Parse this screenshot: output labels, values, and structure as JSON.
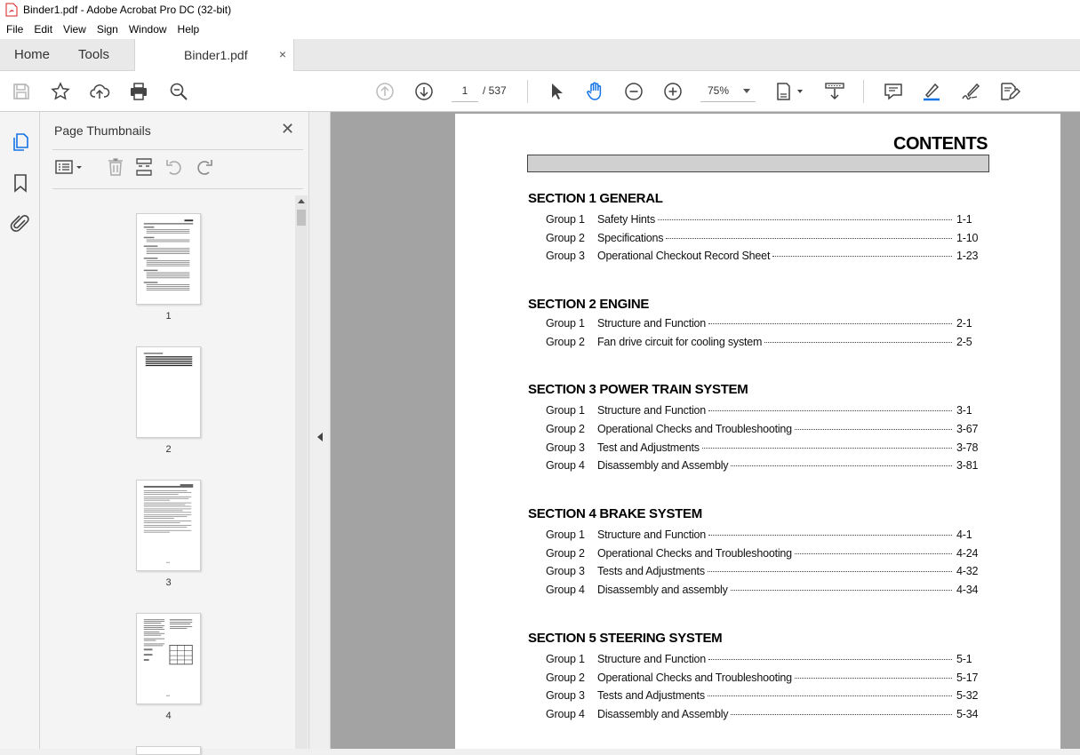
{
  "window": {
    "title": "Binder1.pdf - Adobe Acrobat Pro DC (32-bit)"
  },
  "menu": [
    "File",
    "Edit",
    "View",
    "Sign",
    "Window",
    "Help"
  ],
  "tabs": {
    "home": "Home",
    "tools": "Tools",
    "document": "Binder1.pdf",
    "close": "×"
  },
  "toolbar": {
    "page_current": "1",
    "page_total": "/ 537",
    "zoom": "75%"
  },
  "panel": {
    "title": "Page Thumbnails",
    "close": "✕",
    "thumbnails": [
      "1",
      "2",
      "3",
      "4"
    ]
  },
  "document": {
    "title": "CONTENTS",
    "sections": [
      {
        "heading": "SECTION 1  GENERAL",
        "entries": [
          {
            "group": "Group   1",
            "title": "Safety Hints",
            "page": "1-1"
          },
          {
            "group": "Group   2",
            "title": "Specifications",
            "page": "1-10"
          },
          {
            "group": "Group   3",
            "title": "Operational Checkout Record Sheet",
            "page": "1-23"
          }
        ]
      },
      {
        "heading": "SECTION 2  ENGINE",
        "entries": [
          {
            "group": "Group   1",
            "title": "Structure and Function",
            "page": "2-1"
          },
          {
            "group": "Group   2",
            "title": "Fan drive circuit for cooling system",
            "page": "2-5"
          }
        ]
      },
      {
        "heading": "SECTION 3  POWER TRAIN SYSTEM",
        "entries": [
          {
            "group": "Group   1",
            "title": "Structure and Function",
            "page": "3-1"
          },
          {
            "group": "Group   2",
            "title": "Operational Checks and Troubleshooting",
            "page": "3-67"
          },
          {
            "group": "Group   3",
            "title": "Test and Adjustments",
            "page": "3-78"
          },
          {
            "group": "Group   4",
            "title": "Disassembly and Assembly",
            "page": "3-81"
          }
        ]
      },
      {
        "heading": "SECTION 4  BRAKE SYSTEM",
        "entries": [
          {
            "group": "Group   1",
            "title": "Structure and Function",
            "page": "4-1"
          },
          {
            "group": "Group   2",
            "title": "Operational Checks and Troubleshooting",
            "page": "4-24"
          },
          {
            "group": "Group   3",
            "title": "Tests and Adjustments",
            "page": "4-32"
          },
          {
            "group": "Group   4",
            "title": "Disassembly and assembly",
            "page": "4-34"
          }
        ]
      },
      {
        "heading": "SECTION 5  STEERING SYSTEM",
        "entries": [
          {
            "group": "Group   1",
            "title": "Structure and Function",
            "page": "5-1"
          },
          {
            "group": "Group   2",
            "title": "Operational Checks and Troubleshooting",
            "page": "5-17"
          },
          {
            "group": "Group   3",
            "title": "Tests and Adjustments",
            "page": "5-32"
          },
          {
            "group": "Group   4",
            "title": "Disassembly and Assembly",
            "page": "5-34"
          }
        ]
      }
    ]
  },
  "colors": {
    "accent": "#1473e6",
    "pdf_red": "#d71e1e"
  }
}
